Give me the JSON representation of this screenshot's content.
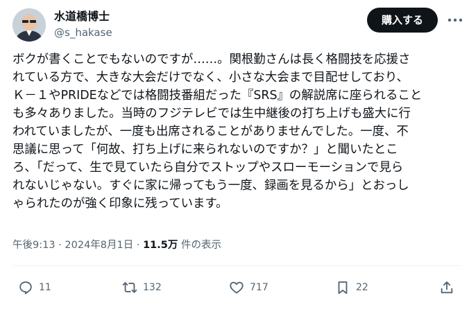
{
  "author": {
    "display_name": "水道橋博士",
    "handle": "@s_hakase"
  },
  "header": {
    "subscribe_label": "購入する",
    "more_icon": "more-dots-icon"
  },
  "post": {
    "text": "ボクが書くことでもないのですが……。関根勤さんは長く格闘技を応援さ\nれている方で、大きな大会だけでなく、小さな大会まで目配せしており、\nＫ－１やPRIDEなどでは格闘技番組だった『SRS』の解説席に座られること\nも多々ありました。当時のフジテレビでは生中継後の打ち上げも盛大に行\nわれていましたが、一度も出席されることがありませんでした。一度、不\n思議に思って「何故、打ち上げに来られないのですか？」と聞いたとこ\nろ、「だって、生で見ていたら自分でストップやスローモーションで見ら\nれないじゃない。すぐに家に帰ってもう一度、録画を見るから」とおっし\nゃられたのが強く印象に残っています。"
  },
  "meta": {
    "timestamp": "午後9:13 · 2024年8月1日 · ",
    "views_count": "11.5万",
    "views_suffix": " 件の表示"
  },
  "actions": {
    "replies": "11",
    "reposts": "132",
    "likes": "717",
    "bookmarks": "22"
  },
  "colors": {
    "text": "#0f1419",
    "muted": "#536471",
    "button": "#0f1419",
    "divider": "#eff3f4"
  }
}
